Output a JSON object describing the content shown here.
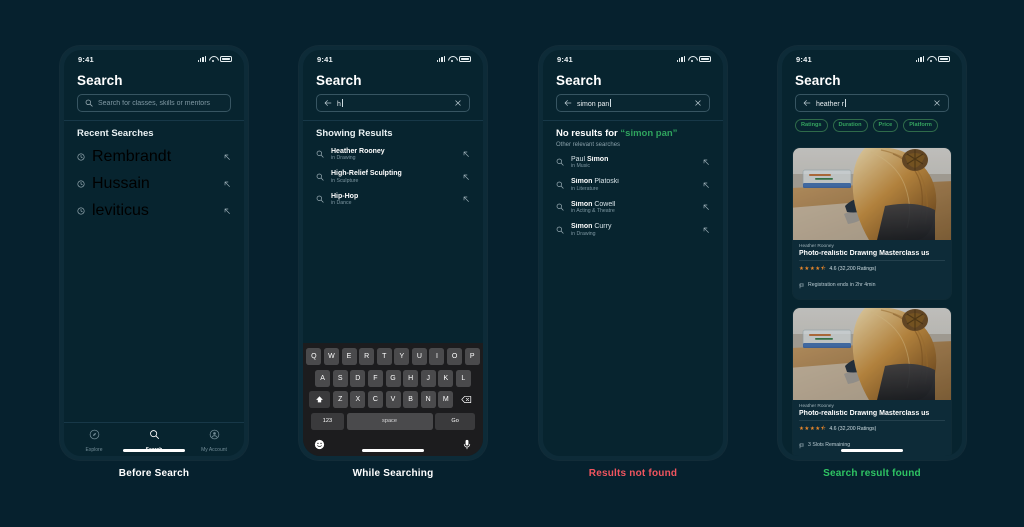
{
  "meta": {
    "background_color": "#06212e",
    "phone_body_color": "#0d2b38",
    "screen_color": "#07242f",
    "accent_green": "#2fa35e",
    "accent_red": "#f0555f",
    "star_orange": "#e8862a"
  },
  "status_bar": {
    "time": "9:41"
  },
  "captions": [
    {
      "label": "Before Search",
      "color": "#ffffff"
    },
    {
      "label": "While Searching",
      "color": "#ffffff"
    },
    {
      "label": "Results not found",
      "color": "#f0555f"
    },
    {
      "label": "Search result found",
      "color": "#2fc463"
    }
  ],
  "screen1": {
    "title": "Search",
    "search": {
      "placeholder": "Search for classes, skills or mentors",
      "value": ""
    },
    "section_title": "Recent Searches",
    "recent": [
      {
        "label": "Rembrandt"
      },
      {
        "label": "Hussain"
      },
      {
        "label": "leviticus"
      }
    ],
    "tabs": [
      {
        "label": "Explore",
        "icon": "compass-icon",
        "active": false
      },
      {
        "label": "Search",
        "icon": "search-icon",
        "active": true
      },
      {
        "label": "My Account",
        "icon": "account-icon",
        "active": false
      }
    ]
  },
  "screen2": {
    "title": "Search",
    "search": {
      "value": "h"
    },
    "section_title": "Showing Results",
    "results": [
      {
        "name": "Heather Rooney",
        "category": "in Drawing"
      },
      {
        "name": "High-Relief Sculpting",
        "category": "in Sculpture"
      },
      {
        "name": "Hip-Hop",
        "category": "in Dance"
      }
    ],
    "keyboard": {
      "row1": [
        "Q",
        "W",
        "E",
        "R",
        "T",
        "Y",
        "U",
        "I",
        "O",
        "P"
      ],
      "row2": [
        "A",
        "S",
        "D",
        "F",
        "G",
        "H",
        "J",
        "K",
        "L"
      ],
      "row3": [
        "Z",
        "X",
        "C",
        "V",
        "B",
        "N",
        "M"
      ],
      "shift_label": "shift-key",
      "backspace_label": "backspace-key",
      "numbers_label": "123",
      "space_label": "space",
      "go_label": "Go",
      "emoji_label": "emoji-key",
      "mic_label": "mic-key"
    }
  },
  "screen3": {
    "title": "Search",
    "search": {
      "value": "simon pan"
    },
    "no_results_prefix": "No results for ",
    "no_results_query": "“simon pan”",
    "other_label": "Other relevant searches",
    "results": [
      {
        "pre": "Paul ",
        "bold": "Simon",
        "post": "",
        "category": "in Music"
      },
      {
        "pre": "",
        "bold": "Simon",
        "post": " Platoski",
        "category": "in Literature"
      },
      {
        "pre": "",
        "bold": "Simon",
        "post": " Cowell",
        "category": "in Acting & Theatre"
      },
      {
        "pre": "",
        "bold": "Simon",
        "post": " Curry",
        "category": "in Drawing"
      }
    ]
  },
  "screen4": {
    "title": "Search",
    "search": {
      "value": "heather r"
    },
    "filters": [
      "Ratings",
      "Duration",
      "Price",
      "Platform"
    ],
    "cards": [
      {
        "author": "Heather Rooney",
        "title": "Photo-realistic Drawing Masterclass us",
        "stars": "★★★★⯪",
        "rating_text": "4.6 (32,200 Ratings)",
        "meta": "Registration ends in 2hr 4min",
        "meta_icon": "flag-icon"
      },
      {
        "author": "Heather Rooney",
        "title": "Photo-realistic Drawing Masterclass us",
        "stars": "★★★★⯪",
        "rating_text": "4.6 (32,200 Ratings)",
        "meta": "3 Slots Remaining",
        "meta_icon": "flag-icon"
      }
    ]
  }
}
